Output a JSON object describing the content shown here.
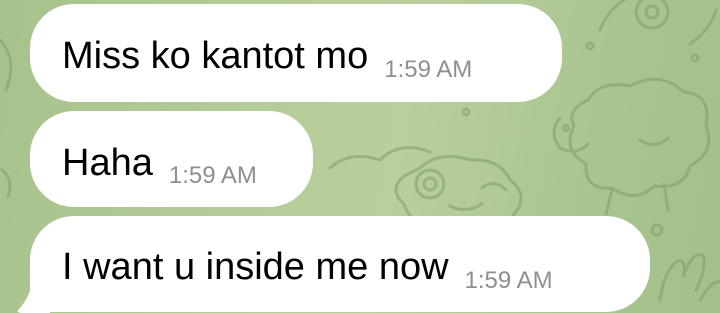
{
  "messages": [
    {
      "text": "Miss ko kantot mo",
      "time": "1:59 AM"
    },
    {
      "text": "Haha",
      "time": "1:59 AM"
    },
    {
      "text": "I want u inside me now",
      "time": "1:59 AM"
    }
  ],
  "colors": {
    "bubble": "#ffffff",
    "timestamp": "#8e8e93",
    "wallpaper": "#b4cc98"
  },
  "icons": [
    "bubble-tail-icon"
  ]
}
